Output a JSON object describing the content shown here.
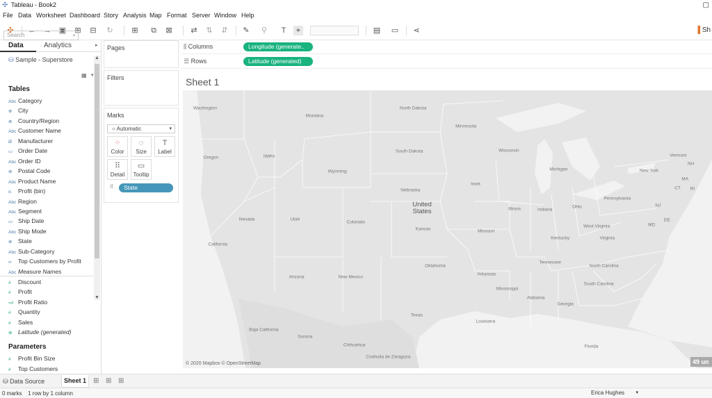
{
  "window": {
    "title": "Tableau - Book2",
    "controls": "▢"
  },
  "menu": [
    "File",
    "Data",
    "Worksheet",
    "Dashboard",
    "Story",
    "Analysis",
    "Map",
    "Format",
    "Server",
    "Window",
    "Help"
  ],
  "toolbar": {
    "show_me": "Sh"
  },
  "left_pane": {
    "tab_data": "Data",
    "tab_analytics": "Analytics",
    "datasource": "Sample - Superstore",
    "search_placeholder": "Search",
    "tables_header": "Tables",
    "dimensions": [
      {
        "icon": "Abc",
        "label": "Category"
      },
      {
        "icon": "⊕",
        "label": "City"
      },
      {
        "icon": "⊕",
        "label": "Country/Region"
      },
      {
        "icon": "Abc",
        "label": "Customer Name"
      },
      {
        "icon": "Ø",
        "label": "Manufacturer"
      },
      {
        "icon": "▭",
        "label": "Order Date"
      },
      {
        "icon": "Abc",
        "label": "Order ID"
      },
      {
        "icon": "⊕",
        "label": "Postal Code"
      },
      {
        "icon": "Abc",
        "label": "Product Name"
      },
      {
        "icon": "ıl.",
        "label": "Profit (bin)"
      },
      {
        "icon": "Abc",
        "label": "Region"
      },
      {
        "icon": "Abc",
        "label": "Segment"
      },
      {
        "icon": "▭",
        "label": "Ship Date"
      },
      {
        "icon": "Abc",
        "label": "Ship Mode"
      },
      {
        "icon": "⊕",
        "label": "State"
      },
      {
        "icon": "Abc",
        "label": "Sub-Category"
      },
      {
        "icon": "∞",
        "label": "Top Customers by Profit"
      },
      {
        "icon": "Abc",
        "label": "Measure Names"
      }
    ],
    "measures": [
      {
        "icon": "#",
        "label": "Discount"
      },
      {
        "icon": "#",
        "label": "Profit"
      },
      {
        "icon": "=#",
        "label": "Profit Ratio"
      },
      {
        "icon": "#",
        "label": "Quantity"
      },
      {
        "icon": "#",
        "label": "Sales"
      },
      {
        "icon": "⊕",
        "label": "Latitude (generated)"
      }
    ],
    "parameters_header": "Parameters",
    "parameters": [
      {
        "icon": "#",
        "label": "Profit Bin Size"
      },
      {
        "icon": "#",
        "label": "Top Customers"
      }
    ]
  },
  "cards": {
    "pages": "Pages",
    "filters": "Filters",
    "marks": "Marks",
    "mark_type": "Automatic",
    "mark_buttons": [
      {
        "icon": "⁘",
        "label": "Color"
      },
      {
        "icon": "◌",
        "label": "Size"
      },
      {
        "icon": "T",
        "label": "Label"
      },
      {
        "icon": "⠿",
        "label": "Detail"
      },
      {
        "icon": "▭",
        "label": "Tooltip"
      }
    ],
    "state_pill": "State"
  },
  "shelves": {
    "columns_label": "Columns",
    "columns_pill": "Longitude (generate..",
    "rows_label": "Rows",
    "rows_pill": "Latitude (generated)"
  },
  "sheet": {
    "title": "Sheet 1"
  },
  "map": {
    "attribution": "© 2020 Mapbox © OpenStreetMap",
    "mark_count_badge": "49 un",
    "country_label": "United States",
    "country_line1": "United",
    "country_line2": "States",
    "state_labels": [
      {
        "t": "Washington",
        "x": 4.2,
        "y": 6.5
      },
      {
        "t": "Oregon",
        "x": 5.3,
        "y": 24.3
      },
      {
        "t": "California",
        "x": 6.6,
        "y": 55.5
      },
      {
        "t": "Idaho",
        "x": 16.3,
        "y": 23.8
      },
      {
        "t": "Montana",
        "x": 24.9,
        "y": 9.3
      },
      {
        "t": "Nevada",
        "x": 12.1,
        "y": 46.5
      },
      {
        "t": "Utah",
        "x": 21.2,
        "y": 46.5
      },
      {
        "t": "Wyoming",
        "x": 29.2,
        "y": 29.2
      },
      {
        "t": "Colorado",
        "x": 32.7,
        "y": 47.5
      },
      {
        "t": "Arizona",
        "x": 21.5,
        "y": 67.3
      },
      {
        "t": "New Mexico",
        "x": 31.7,
        "y": 67.3
      },
      {
        "t": "North Dakota",
        "x": 43.5,
        "y": 6.6
      },
      {
        "t": "South Dakota",
        "x": 42.8,
        "y": 21.9
      },
      {
        "t": "Nebraska",
        "x": 43.0,
        "y": 36.0
      },
      {
        "t": "Kansas",
        "x": 45.4,
        "y": 50.0
      },
      {
        "t": "Oklahoma",
        "x": 47.7,
        "y": 63.2
      },
      {
        "t": "Texas",
        "x": 44.2,
        "y": 81.0
      },
      {
        "t": "Minnesota",
        "x": 53.5,
        "y": 13.0
      },
      {
        "t": "Iowa",
        "x": 55.3,
        "y": 33.8
      },
      {
        "t": "Missouri",
        "x": 57.3,
        "y": 50.7
      },
      {
        "t": "Arkansas",
        "x": 57.4,
        "y": 66.3
      },
      {
        "t": "Louisiana",
        "x": 57.2,
        "y": 83.3
      },
      {
        "t": "Wisconsin",
        "x": 61.6,
        "y": 21.7
      },
      {
        "t": "Illinois",
        "x": 62.7,
        "y": 42.8
      },
      {
        "t": "Michigan",
        "x": 71.0,
        "y": 28.4
      },
      {
        "t": "Indiana",
        "x": 68.4,
        "y": 43.0
      },
      {
        "t": "Ohio",
        "x": 74.5,
        "y": 41.9
      },
      {
        "t": "Kentucky",
        "x": 71.3,
        "y": 53.2
      },
      {
        "t": "Tennessee",
        "x": 69.4,
        "y": 62.0
      },
      {
        "t": "Mississippi",
        "x": 61.3,
        "y": 71.5
      },
      {
        "t": "Alabama",
        "x": 66.7,
        "y": 74.7
      },
      {
        "t": "Georgia",
        "x": 72.3,
        "y": 77.1
      },
      {
        "t": "Florida",
        "x": 77.2,
        "y": 92.3
      },
      {
        "t": "South Carolina",
        "x": 78.6,
        "y": 69.8
      },
      {
        "t": "North Carolina",
        "x": 79.6,
        "y": 63.3
      },
      {
        "t": "Virginia",
        "x": 80.2,
        "y": 53.3
      },
      {
        "t": "West Virginia",
        "x": 78.2,
        "y": 49.0
      },
      {
        "t": "Pennsylvania",
        "x": 82.1,
        "y": 38.9
      },
      {
        "t": "New York",
        "x": 88.1,
        "y": 28.9
      },
      {
        "t": "Vermont",
        "x": 93.6,
        "y": 23.5
      },
      {
        "t": "NH",
        "x": 96.0,
        "y": 26.5
      },
      {
        "t": "MA",
        "x": 94.9,
        "y": 32.1
      },
      {
        "t": "CT",
        "x": 93.5,
        "y": 35.2
      },
      {
        "t": "RI",
        "x": 96.3,
        "y": 35.5
      },
      {
        "t": "NJ",
        "x": 89.8,
        "y": 41.6
      },
      {
        "t": "MD",
        "x": 88.6,
        "y": 48.5
      },
      {
        "t": "DE",
        "x": 91.5,
        "y": 46.8
      },
      {
        "t": "Baja California",
        "x": 15.3,
        "y": 86.2
      },
      {
        "t": "Sonora",
        "x": 23.1,
        "y": 88.7
      },
      {
        "t": "Chihuahua",
        "x": 32.4,
        "y": 91.7
      },
      {
        "t": "Coahuila de Zaragoza",
        "x": 38.8,
        "y": 96.0
      }
    ]
  },
  "sheet_tabs": {
    "data_source": "Data Source",
    "sheet1": "Sheet 1"
  },
  "status": {
    "marks": "0 marks",
    "dims": "1 row by 1 column",
    "user": "Erica Hughes"
  }
}
